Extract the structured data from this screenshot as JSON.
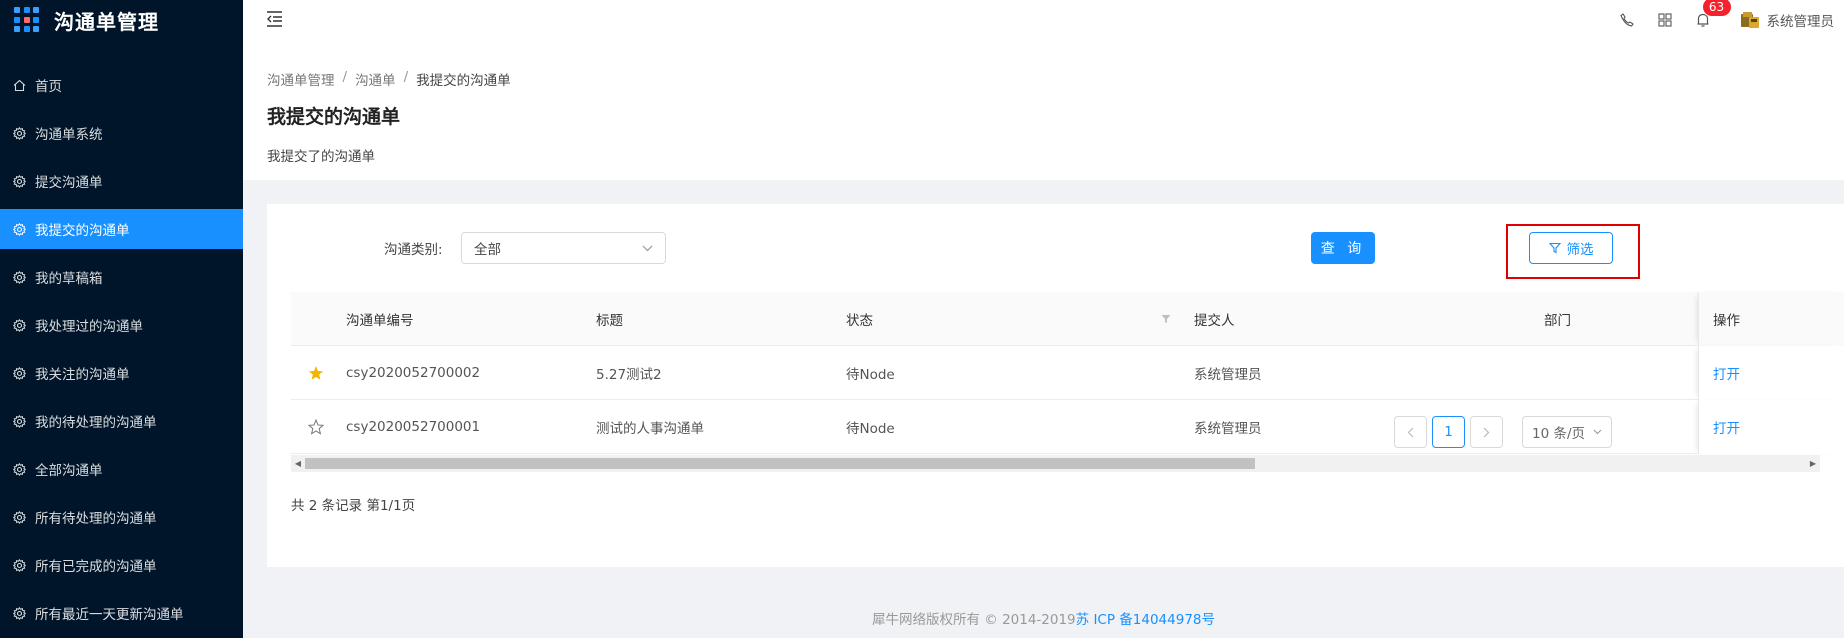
{
  "app": {
    "title": "沟通单管理"
  },
  "sidebar": {
    "items": [
      {
        "label": "首页",
        "icon": "home-icon",
        "active": false
      },
      {
        "label": "沟通单系统",
        "icon": "gear-icon",
        "active": false
      },
      {
        "label": "提交沟通单",
        "icon": "gear-icon",
        "active": false
      },
      {
        "label": "我提交的沟通单",
        "icon": "gear-icon",
        "active": true
      },
      {
        "label": "我的草稿箱",
        "icon": "gear-icon",
        "active": false
      },
      {
        "label": "我处理过的沟通单",
        "icon": "gear-icon",
        "active": false
      },
      {
        "label": "我关注的沟通单",
        "icon": "gear-icon",
        "active": false
      },
      {
        "label": "我的待处理的沟通单",
        "icon": "gear-icon",
        "active": false
      },
      {
        "label": "全部沟通单",
        "icon": "gear-icon",
        "active": false
      },
      {
        "label": "所有待处理的沟通单",
        "icon": "gear-icon",
        "active": false
      },
      {
        "label": "所有已完成的沟通单",
        "icon": "gear-icon",
        "active": false
      },
      {
        "label": "所有最近一天更新沟通单",
        "icon": "gear-icon",
        "active": false
      }
    ]
  },
  "header": {
    "notification_count": "63",
    "user_name": "系统管理员"
  },
  "breadcrumb": [
    "沟通单管理",
    "沟通单",
    "我提交的沟通单"
  ],
  "page": {
    "title": "我提交的沟通单",
    "description": "我提交了的沟通单"
  },
  "filter": {
    "category_label": "沟通类别:",
    "category_value": "全部",
    "query_button": "查 询",
    "filter_button": "筛选"
  },
  "table": {
    "columns": {
      "id": "沟通单编号",
      "title": "标题",
      "status": "状态",
      "submitter": "提交人",
      "department": "部门",
      "operation": "操作"
    },
    "rows": [
      {
        "starred": true,
        "id": "csy2020052700002",
        "title": "5.27测试2",
        "status": "待Node",
        "submitter": "系统管理员",
        "department": "",
        "action": "打开"
      },
      {
        "starred": false,
        "id": "csy2020052700001",
        "title": "测试的人事沟通单",
        "status": "待Node",
        "submitter": "系统管理员",
        "department": "",
        "action": "打开"
      }
    ]
  },
  "pagination": {
    "summary": "共 2 条记录 第1/1页",
    "current_page": "1",
    "page_size": "10 条/页"
  },
  "footer": {
    "copyright": "犀牛网络版权所有 © 2014-2019",
    "icp": "苏 ICP 备14044978号"
  },
  "colors": {
    "sidebar_bg": "#001529",
    "accent": "#1890ff",
    "highlight_border": "#e00000",
    "star_filled": "#f5b400"
  }
}
